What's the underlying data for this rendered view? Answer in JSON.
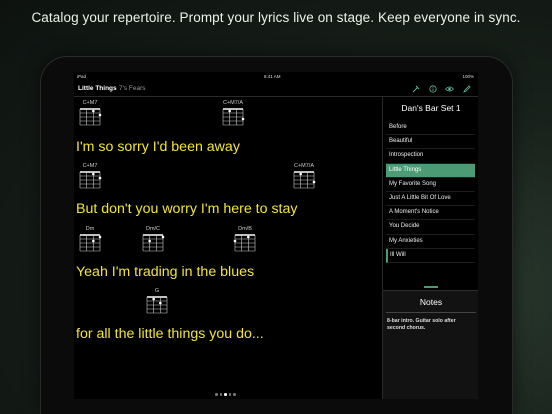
{
  "tagline": "Catalog your repertoire. Prompt your lyrics live on stage. Keep everyone in sync.",
  "status": {
    "device": "iPad",
    "time": "8:41 AM",
    "battery": "100%"
  },
  "nav": {
    "title": "Little Things",
    "subtitle": "7's Fears"
  },
  "nav_icons": [
    "tuning-fork-icon",
    "info-icon",
    "eye-icon",
    "edit-icon"
  ],
  "chords": [
    {
      "name": "C+M7"
    },
    {
      "name": "C+M7/A"
    },
    {
      "name": "C+M7"
    },
    {
      "name": "C+M7/A"
    },
    {
      "name": "Dm"
    },
    {
      "name": "Dm/C"
    },
    {
      "name": "Dm/B"
    },
    {
      "name": "G"
    }
  ],
  "lyrics": [
    "I'm so sorry I'd been away",
    "But don't you worry I'm here to stay",
    "Yeah I'm trading in the blues",
    "for all the little things you do..."
  ],
  "set": {
    "title": "Dan's Bar Set 1",
    "items": [
      "Before",
      "Beautiful",
      "Introspection",
      "Little Things",
      "My Favorite Song",
      "Just A Little Bit Of Love",
      "A Moment's Notice",
      "You Decide",
      "My Anxieties",
      "Ill Will"
    ],
    "active": "Little Things"
  },
  "notes": {
    "title": "Notes",
    "text": "8-bar intro. Guitar solo after second chorus."
  },
  "page_dots": {
    "count": 5,
    "active": 2
  },
  "colors": {
    "lyric": "#f2e632",
    "accent": "#4b9b74"
  }
}
